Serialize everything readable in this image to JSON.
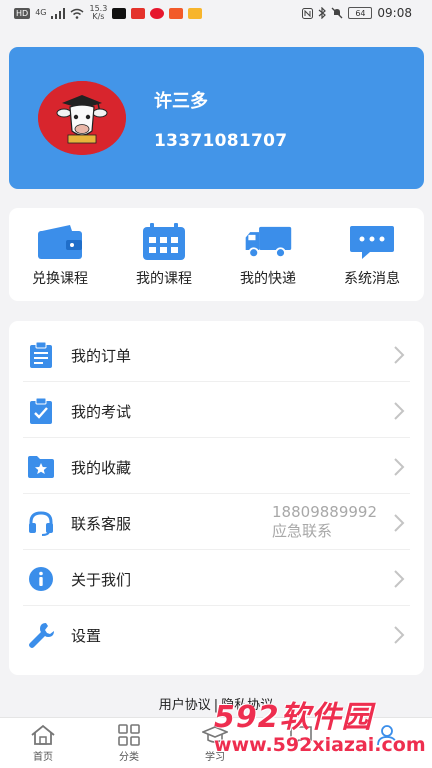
{
  "status_bar": {
    "net_chip": "HD",
    "signal": "4G",
    "speed_value": "15.3",
    "speed_unit": "K/s",
    "battery": "64",
    "time": "09:08",
    "app_colors": [
      "#111111",
      "#e4322b",
      "#e6162d",
      "#f25a29",
      "#f7b52c"
    ]
  },
  "profile": {
    "name": "许三多",
    "phone": "13371081707",
    "card_color": "#4395e8",
    "avatar_bg": "#d8252d"
  },
  "quick_actions": [
    {
      "label": "兑换课程",
      "icon": "wallet-icon"
    },
    {
      "label": "我的课程",
      "icon": "calendar-icon"
    },
    {
      "label": "我的快递",
      "icon": "truck-icon"
    },
    {
      "label": "系统消息",
      "icon": "chat-bubble-icon"
    }
  ],
  "menu": [
    {
      "label": "我的订单",
      "icon": "clipboard-icon"
    },
    {
      "label": "我的考试",
      "icon": "clipboard-check-icon"
    },
    {
      "label": "我的收藏",
      "icon": "folder-star-icon"
    },
    {
      "label": "联系客服",
      "icon": "headset-icon",
      "phone": "18809889992",
      "phone_note": "应急联系"
    },
    {
      "label": "关于我们",
      "icon": "info-icon"
    },
    {
      "label": "设置",
      "icon": "wrench-icon"
    }
  ],
  "agreements": {
    "user_agreement": "用户协议",
    "separator": "|",
    "privacy_agreement": "隐私协议"
  },
  "bottom_nav": [
    {
      "label": "首页",
      "icon": "home-icon"
    },
    {
      "label": "分类",
      "icon": "grid-icon"
    },
    {
      "label": "学习",
      "icon": "mortarboard-icon"
    },
    {
      "label": "",
      "icon": "chat-icon"
    },
    {
      "label": "",
      "icon": "profile-icon"
    }
  ],
  "watermark": {
    "logo": "592软件园",
    "url": "www.592xiazai.com"
  },
  "accent_color": "#3b8eea"
}
